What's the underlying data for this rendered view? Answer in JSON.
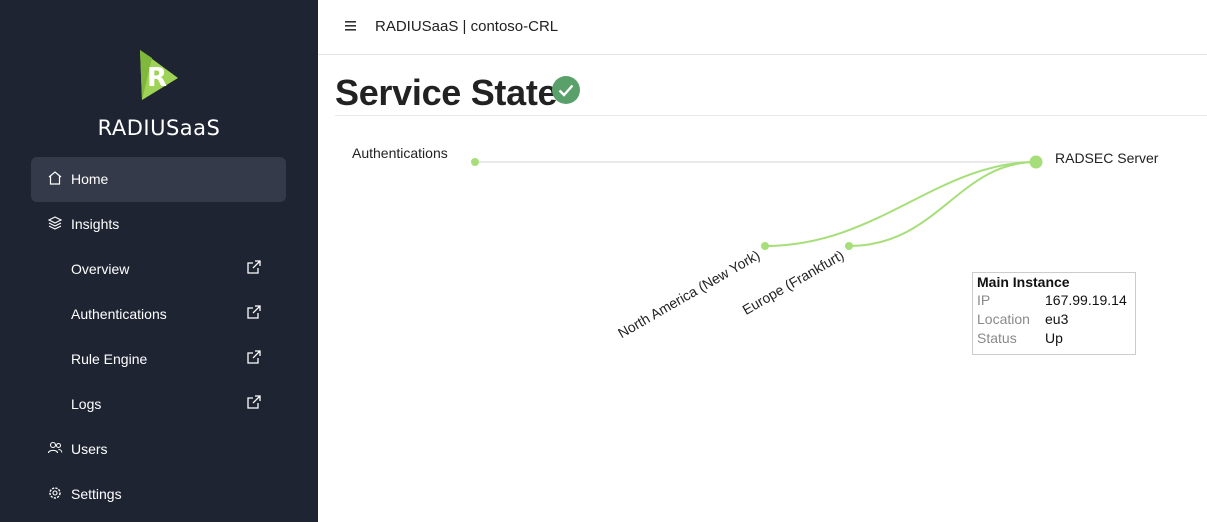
{
  "sidebar": {
    "brand": "RADIUSaaS",
    "items": [
      {
        "label": "Home",
        "icon": "home-icon"
      },
      {
        "label": "Insights",
        "icon": "layers-icon"
      },
      {
        "label": "Overview",
        "icon": "external-link-icon"
      },
      {
        "label": "Authentications",
        "icon": "external-link-icon"
      },
      {
        "label": "Rule Engine",
        "icon": "external-link-icon"
      },
      {
        "label": "Logs",
        "icon": "external-link-icon"
      },
      {
        "label": "Users",
        "icon": "users-icon"
      },
      {
        "label": "Settings",
        "icon": "gear-icon"
      }
    ]
  },
  "header": {
    "breadcrumb": "RADIUSaaS | contoso-CRL"
  },
  "main": {
    "title": "Service State",
    "diagram": {
      "nodes": {
        "authentications": "Authentications",
        "radsec_server": "RADSEC Server",
        "north_america": "North America (New York)",
        "europe": "Europe (Frankfurt)"
      }
    },
    "tooltip": {
      "title": "Main Instance",
      "rows": [
        {
          "key": "IP",
          "value": "167.99.19.14"
        },
        {
          "key": "Location",
          "value": "eu3"
        },
        {
          "key": "Status",
          "value": "Up"
        }
      ]
    }
  },
  "colors": {
    "sidebar_bg": "#1f2433",
    "active_item_bg": "#353a4a",
    "accent_green": "#5aa06a",
    "link_green": "#a6df7a",
    "logo_green": "#9fd356"
  }
}
